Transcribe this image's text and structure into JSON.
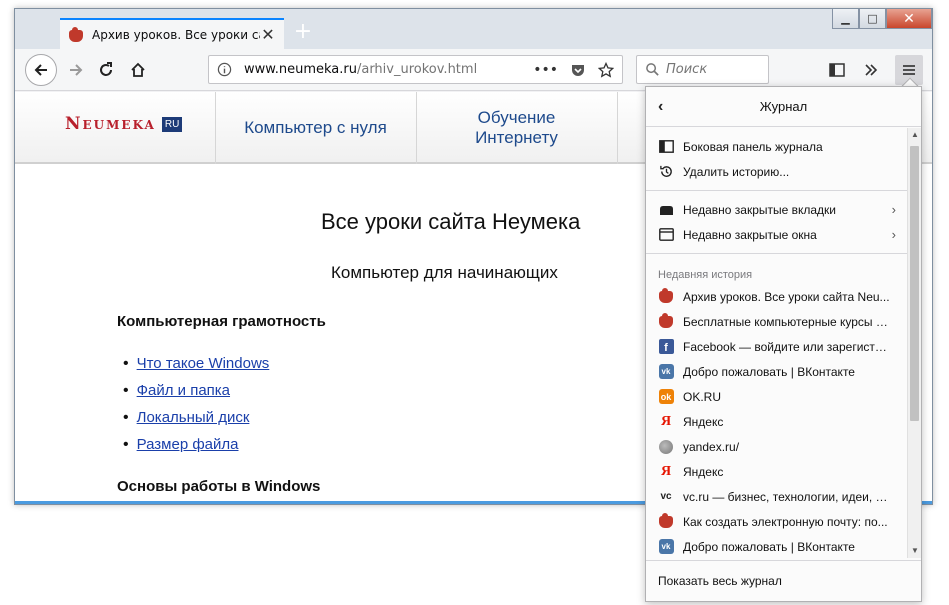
{
  "browser": {
    "tab_title": "Архив уроков. Все уроки сай",
    "tab_close": "✕",
    "new_tab": "+",
    "url_host": "www.neumeka.ru",
    "url_path": "/arhiv_urokov.html",
    "search_placeholder": "Поиск",
    "minimize": "▁",
    "maximize": "□",
    "close": "✕"
  },
  "site": {
    "logo": "Neumeka",
    "logo_ru": "RU",
    "menu": [
      "Компьютер с нуля",
      "Обучение\nИнтернету"
    ],
    "title": "Все уроки сайта Неумека",
    "subtitle": "Компьютер для начинающих",
    "section1": "Компьютерная грамотность",
    "lessons": [
      "Что такое Windows",
      "Файл и папка",
      "Локальный диск",
      "Размер файла"
    ],
    "section2": "Основы работы в Windows"
  },
  "panel": {
    "title": "Журнал",
    "sidebar_item": "Боковая панель журнала",
    "clear_item": "Удалить историю...",
    "closed_tabs": "Недавно закрытые вкладки",
    "closed_windows": "Недавно закрытые окна",
    "recent_heading": "Недавняя история",
    "history": [
      {
        "icon": "teapot",
        "label": "Архив уроков. Все уроки сайта Neu..."
      },
      {
        "icon": "teapot",
        "label": "Бесплатные компьютерные курсы Н..."
      },
      {
        "icon": "facebook",
        "label": "Facebook — войдите или зарегистри..."
      },
      {
        "icon": "vk",
        "label": "Добро пожаловать | ВКонтакте"
      },
      {
        "icon": "ok",
        "label": "OK.RU"
      },
      {
        "icon": "yandex",
        "label": "Яндекс"
      },
      {
        "icon": "globe",
        "label": "yandex.ru/"
      },
      {
        "icon": "yandex",
        "label": "Яндекс"
      },
      {
        "icon": "vc",
        "label": "vc.ru — бизнес, технологии, идеи, м..."
      },
      {
        "icon": "teapot",
        "label": "Как создать электронную почту: по..."
      },
      {
        "icon": "vk",
        "label": "Добро пожаловать | ВКонтакте"
      }
    ],
    "footer": "Показать весь журнал"
  }
}
